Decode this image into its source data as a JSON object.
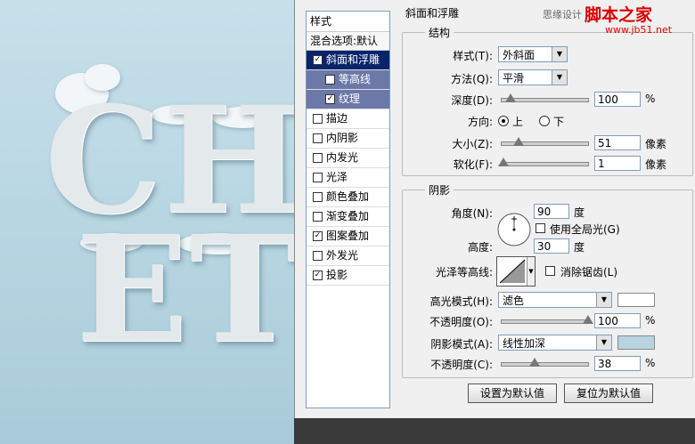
{
  "canvas": {
    "art_line1": "CH",
    "art_line2": "ET"
  },
  "watermark": {
    "brand": "思缘设计",
    "site_name": "脚本之家",
    "url": "www.jb51.net"
  },
  "styles_panel": {
    "header": "样式",
    "blend_options": "混合选项:默认",
    "items": [
      {
        "label": "斜面和浮雕",
        "checked": true,
        "state": "selected"
      },
      {
        "label": "等高线",
        "checked": false,
        "state": "sub"
      },
      {
        "label": "纹理",
        "checked": true,
        "state": "sub"
      },
      {
        "label": "描边",
        "checked": false
      },
      {
        "label": "内阴影",
        "checked": false
      },
      {
        "label": "内发光",
        "checked": false
      },
      {
        "label": "光泽",
        "checked": false
      },
      {
        "label": "颜色叠加",
        "checked": false
      },
      {
        "label": "渐变叠加",
        "checked": false
      },
      {
        "label": "图案叠加",
        "checked": true
      },
      {
        "label": "外发光",
        "checked": false
      },
      {
        "label": "投影",
        "checked": true
      }
    ]
  },
  "bevel": {
    "title": "斜面和浮雕",
    "structure": {
      "title": "结构",
      "style_label": "样式(T):",
      "style_value": "外斜面",
      "technique_label": "方法(Q):",
      "technique_value": "平滑",
      "depth_label": "深度(D):",
      "depth_value": "100",
      "depth_unit": "%",
      "depth_fraction": 0.1,
      "direction_label": "方向:",
      "direction_up": "上",
      "direction_down": "下",
      "direction_selected": "上",
      "size_label": "大小(Z):",
      "size_value": "51",
      "size_unit": "像素",
      "size_fraction": 0.2,
      "soften_label": "软化(F):",
      "soften_value": "1",
      "soften_unit": "像素",
      "soften_fraction": 0.02
    },
    "shading": {
      "title": "阴影",
      "angle_label": "角度(N):",
      "angle_value": "90",
      "angle_unit": "度",
      "global_light_label": "使用全局光(G)",
      "global_light_checked": false,
      "altitude_label": "高度:",
      "altitude_value": "30",
      "altitude_unit": "度",
      "gloss_label": "光泽等高线:",
      "antialias_label": "消除锯齿(L)",
      "antialias_checked": false,
      "highlight_mode_label": "高光模式(H):",
      "highlight_mode_value": "滤色",
      "highlight_color": "#ffffff",
      "highlight_opacity_label": "不透明度(O):",
      "highlight_opacity_value": "100",
      "highlight_opacity_unit": "%",
      "highlight_opacity_fraction": 1.0,
      "shadow_mode_label": "阴影模式(A):",
      "shadow_mode_value": "线性加深",
      "shadow_color": "#b9d3e0",
      "shadow_opacity_label": "不透明度(C):",
      "shadow_opacity_value": "38",
      "shadow_opacity_unit": "%",
      "shadow_opacity_fraction": 0.38
    },
    "buttons": {
      "make_default": "设置为默认值",
      "reset_default": "复位为默认值"
    }
  }
}
